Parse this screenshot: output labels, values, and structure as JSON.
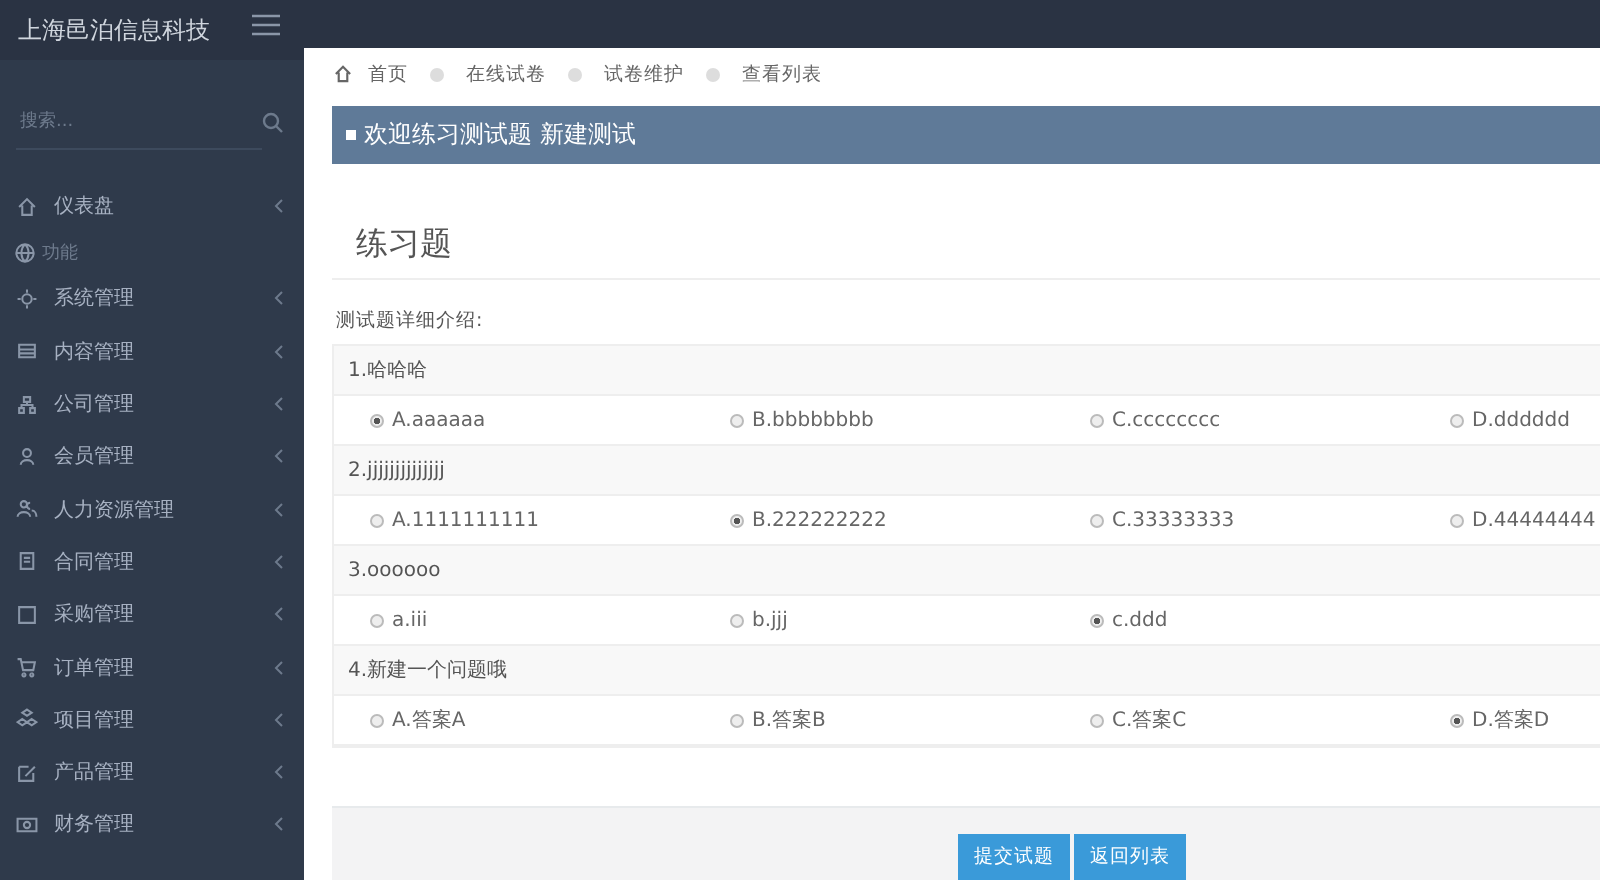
{
  "brand": "上海邑泊信息科技",
  "sidebar": {
    "search_placeholder": "搜索...",
    "items": [
      {
        "label": "仪表盘",
        "kind": "item"
      },
      {
        "label": "功能",
        "kind": "section"
      },
      {
        "label": "系统管理",
        "kind": "item"
      },
      {
        "label": "内容管理",
        "kind": "item"
      },
      {
        "label": "公司管理",
        "kind": "item"
      },
      {
        "label": "会员管理",
        "kind": "item"
      },
      {
        "label": "人力资源管理",
        "kind": "item"
      },
      {
        "label": "合同管理",
        "kind": "item"
      },
      {
        "label": "采购管理",
        "kind": "item"
      },
      {
        "label": "订单管理",
        "kind": "item"
      },
      {
        "label": "项目管理",
        "kind": "item"
      },
      {
        "label": "产品管理",
        "kind": "item"
      },
      {
        "label": "财务管理",
        "kind": "item"
      }
    ]
  },
  "breadcrumb": [
    "首页",
    "在线试卷",
    "试卷维护",
    "查看列表"
  ],
  "panel_title": "欢迎练习测试题 新建测试",
  "heading": "练习题",
  "intro": "测试题详细介绍:",
  "questions": [
    {
      "text": "1.哈哈哈",
      "options": [
        {
          "label": "A.aaaaaa",
          "selected": true
        },
        {
          "label": "B.bbbbbbbb",
          "selected": false
        },
        {
          "label": "C.cccccccc",
          "selected": false
        },
        {
          "label": "D.dddddd",
          "selected": false
        }
      ]
    },
    {
      "text": "2.jjjjjjjjjjjjjj",
      "options": [
        {
          "label": "A.1111111111",
          "selected": false
        },
        {
          "label": "B.222222222",
          "selected": true
        },
        {
          "label": "C.33333333",
          "selected": false
        },
        {
          "label": "D.44444444",
          "selected": false
        }
      ]
    },
    {
      "text": "3.oooooo",
      "options": [
        {
          "label": "a.iii",
          "selected": false
        },
        {
          "label": "b.jjj",
          "selected": false
        },
        {
          "label": "c.ddd",
          "selected": true
        }
      ]
    },
    {
      "text": "4.新建一个问题哦",
      "options": [
        {
          "label": "A.答案A",
          "selected": false
        },
        {
          "label": "B.答案B",
          "selected": false
        },
        {
          "label": "C.答案C",
          "selected": false
        },
        {
          "label": "D.答案D",
          "selected": true
        }
      ]
    }
  ],
  "buttons": [
    "提交试题",
    "返回列表"
  ]
}
